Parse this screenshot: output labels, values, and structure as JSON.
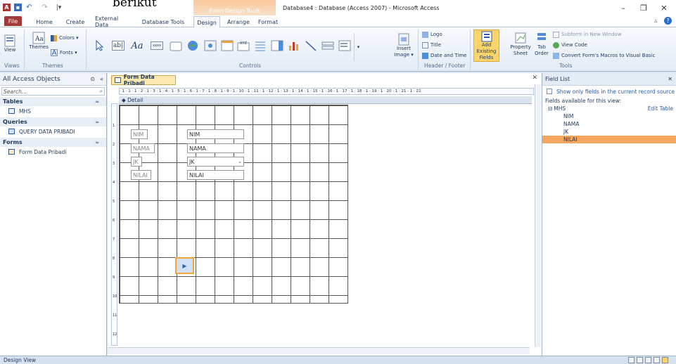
{
  "overlay_text": "berikut",
  "qat": {
    "app_icon": "A",
    "save_icon": "▪",
    "undo_icon": "↶",
    "redo_icon": "↷",
    "more_icon": "|▾"
  },
  "title": {
    "context_tab": "Form Design Tools",
    "window_title": "Database4 : Database (Access 2007) - Microsoft Access"
  },
  "window_controls": {
    "minimize": "–",
    "restore": "❐",
    "close": "✕"
  },
  "ribbon_tabs": [
    {
      "label": "File"
    },
    {
      "label": "Home"
    },
    {
      "label": "Create"
    },
    {
      "label": "External Data"
    },
    {
      "label": "Database Tools"
    },
    {
      "label": "Design"
    },
    {
      "label": "Arrange"
    },
    {
      "label": "Format"
    }
  ],
  "ribbon_right": {
    "help_icon": "?",
    "collapse_icon": "▵"
  },
  "groups": {
    "views": "Views",
    "themes": "Themes",
    "controls": "Controls",
    "header_footer": "Header / Footer",
    "tools": "Tools"
  },
  "buttons": {
    "view": "View",
    "themes": "Themes",
    "colors": "Colors ▾",
    "fonts": "Fonts ▾",
    "insert_image": "Insert Image ▾",
    "logo": "Logo",
    "title": "Title",
    "date_time": "Date and Time",
    "add_existing_fields": "Add Existing Fields",
    "property_sheet": "Property Sheet",
    "tab_order": "Tab Order",
    "subform_new_window": "Subform in New Window",
    "view_code": "View Code",
    "convert_macros": "Convert Form's Macros to Visual Basic"
  },
  "controls": {
    "textbox": "ab|",
    "label": "Aa",
    "button": "xxxx",
    "text_xyz": "XYZ"
  },
  "nav_pane": {
    "header": "All Access Objects",
    "search_placeholder": "Search...",
    "groups": [
      {
        "name": "Tables",
        "items": [
          "MHS"
        ]
      },
      {
        "name": "Queries",
        "items": [
          "QUERY DATA PRIBADI"
        ]
      },
      {
        "name": "Forms",
        "items": [
          "Form Data Pribadi"
        ]
      }
    ]
  },
  "document": {
    "tab_title": "Form Data Pribadi",
    "ruler_text": "· 1 · 1 · 1 · 2 · 1 · 3 · 1 · 4 · 1 · 5 · 1 · 6 · 1 · 7 · 1 · 8 · 1 · 9 · 1 · 10 · 1 · 11 · 1 · 12 · 1 · 13 · 1 · 14 · 1 · 15 · 1 · 16 · 1 · 17 · 1 · 18 · 1 · 19 · 1 · 20 · 1 · 21 · 1 · 22",
    "vruler": [
      "1",
      "2",
      "3",
      "4",
      "5",
      "6",
      "7",
      "8",
      "9",
      "10",
      "11",
      "12"
    ],
    "section": "Detail",
    "labels": [
      "NIM",
      "NAMA",
      "JK",
      "NILAI"
    ],
    "fields": [
      "NIM",
      "NAMA",
      "JK",
      "NILAI"
    ],
    "button_icon": "▶",
    "close_icon": "✕"
  },
  "field_list": {
    "title": "Field List",
    "show_only": "Show only fields in the current record source",
    "available": "Fields available for this view:",
    "table": "MHS",
    "table_toggle": "⊟",
    "edit_table": "Edit Table",
    "fields": [
      "NIM",
      "NAMA",
      "JK",
      "NILAI"
    ],
    "selected_field": "NILAI",
    "close_icon": "✕"
  },
  "status": {
    "text": "Design View"
  }
}
